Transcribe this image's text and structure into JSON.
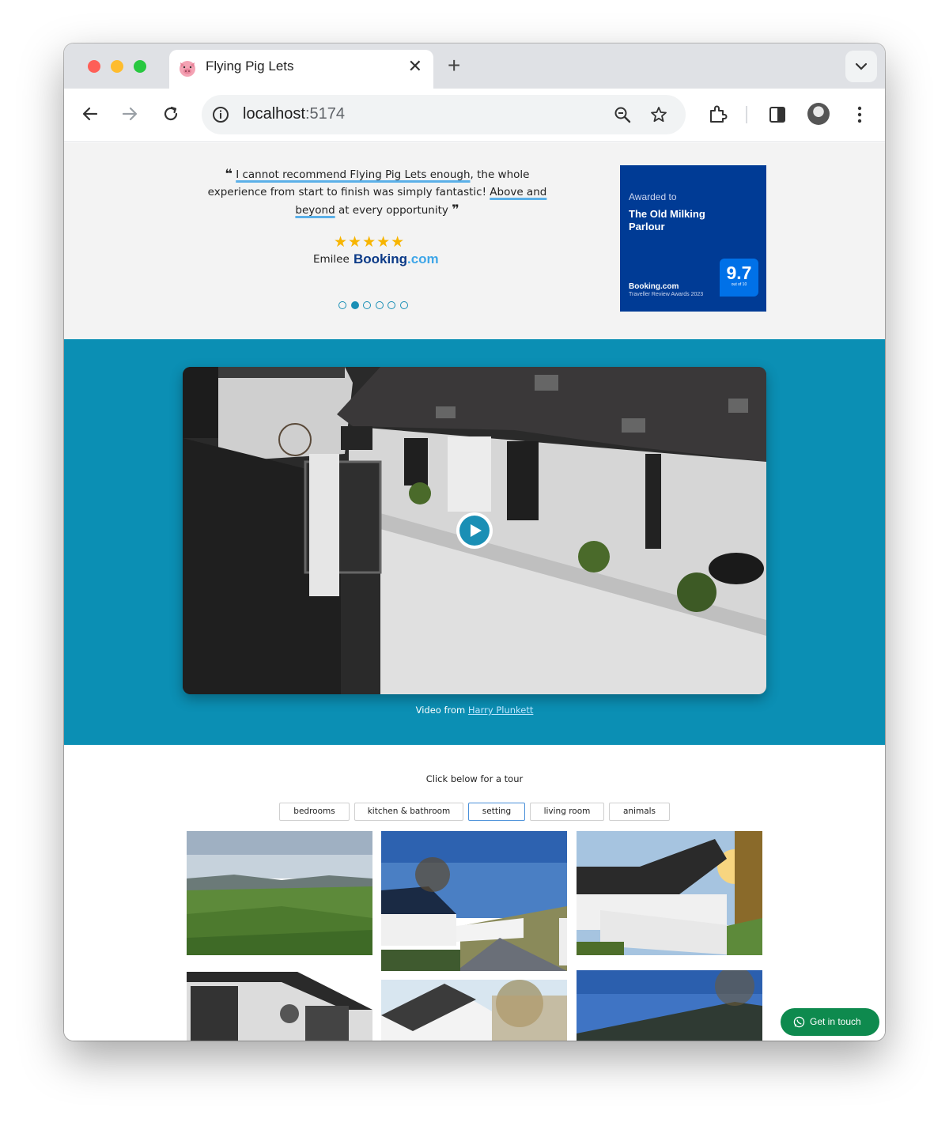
{
  "browser": {
    "tab_title": "Flying Pig Lets",
    "tab_close": "✕",
    "new_tab": "+",
    "url_host": "localhost",
    "url_port": ":5174"
  },
  "testimonial": {
    "quote_highlight_1": "I cannot recommend Flying Pig Lets enough",
    "quote_text_1": ", the whole experience from start to finish was simply fantastic! ",
    "quote_highlight_2": "Above and beyond",
    "quote_text_2": " at every opportunity",
    "stars": "★★★★★",
    "rating": 5,
    "reviewer": "Emilee",
    "source_brand": "Booking",
    "source_suffix": ".com",
    "carousel_count": 6,
    "carousel_active_index": 1
  },
  "award": {
    "label": "Awarded to",
    "property_name": "The Old Milking Parlour",
    "score": "9.7",
    "score_outof": "out of 10",
    "brand": "Booking.com",
    "subtitle": "Traveller Review Awards 2023"
  },
  "video": {
    "credit_prefix": "Video from ",
    "credit_author": "Harry Plunkett"
  },
  "tour": {
    "heading": "Click below for a tour",
    "filters": [
      "bedrooms",
      "kitchen & bathroom",
      "setting",
      "living room",
      "animals"
    ],
    "active_filter": "setting"
  },
  "whatsapp": {
    "label": "Get in touch"
  },
  "colors": {
    "accent": "#0b8fb4",
    "booking_blue": "#003b95",
    "whatsapp_green": "#0e8a4e"
  }
}
